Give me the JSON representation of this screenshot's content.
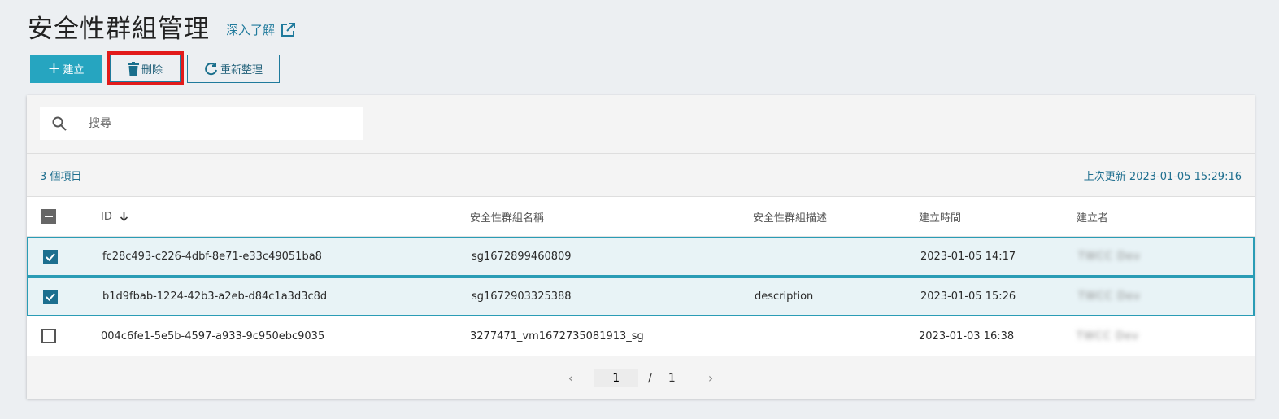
{
  "header": {
    "title": "安全性群組管理",
    "learn_more": "深入了解"
  },
  "toolbar": {
    "create_label": "建立",
    "delete_label": "刪除",
    "refresh_label": "重新整理"
  },
  "search": {
    "placeholder": "搜尋",
    "value": ""
  },
  "info": {
    "item_count": "3 個項目",
    "last_updated": "上次更新 2023-01-05 15:29:16"
  },
  "table": {
    "columns": {
      "id": "ID",
      "name": "安全性群組名稱",
      "description": "安全性群組描述",
      "created_time": "建立時間",
      "creator": "建立者"
    },
    "rows": [
      {
        "id": "fc28c493-c226-4dbf-8e71-e33c49051ba8",
        "name": "sg1672899460809",
        "description": "",
        "created_time": "2023-01-05 14:17",
        "creator": "TWCC Dev",
        "selected": true
      },
      {
        "id": "b1d9fbab-1224-42b3-a2eb-d84c1a3d3c8d",
        "name": "sg1672903325388",
        "description": "description",
        "created_time": "2023-01-05 15:26",
        "creator": "TWCC Dev",
        "selected": true
      },
      {
        "id": "004c6fe1-5e5b-4597-a933-9c950ebc9035",
        "name": "3277471_vm1672735081913_sg",
        "description": "",
        "created_time": "2023-01-03 16:38",
        "creator": "TWCC Dev",
        "selected": false
      }
    ]
  },
  "pagination": {
    "current": "1",
    "separator": "/",
    "total": "1",
    "prev": "‹",
    "next": "›"
  },
  "colors": {
    "primary": "#26a5c0",
    "link": "#1f7a9c",
    "highlight": "#e21a1a"
  }
}
